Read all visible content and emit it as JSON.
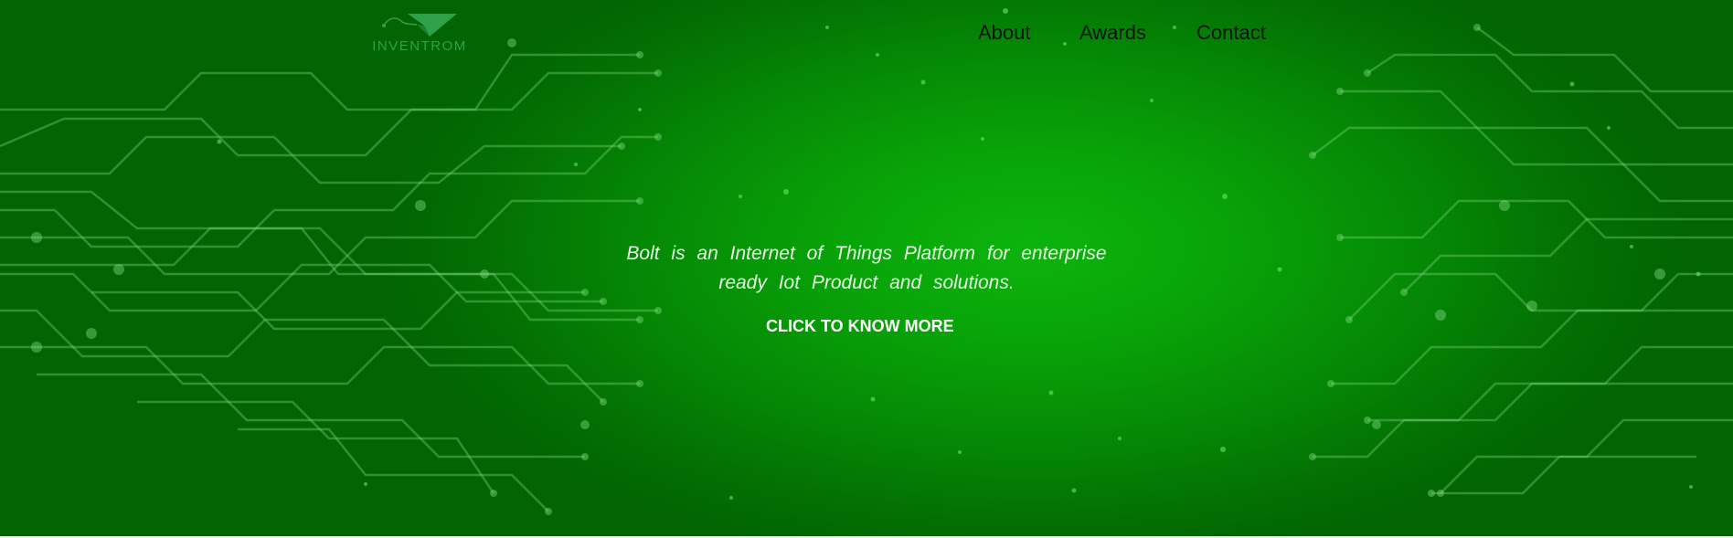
{
  "brand": {
    "logo_text": "INVENTROM"
  },
  "nav": {
    "items": [
      {
        "label": "About"
      },
      {
        "label": "Awards"
      },
      {
        "label": "Contact"
      }
    ]
  },
  "hero": {
    "tagline": "Bolt is an Internet of Things Platform for enterprise ready Iot Product and solutions.",
    "cta_label": "CLICK TO KNOW MORE"
  },
  "theme": {
    "background_center": "#0db40d",
    "background_edge": "#026402",
    "nav_text": "#061406",
    "hero_text": "#ffffff",
    "logo_color": "#2ea24a"
  }
}
